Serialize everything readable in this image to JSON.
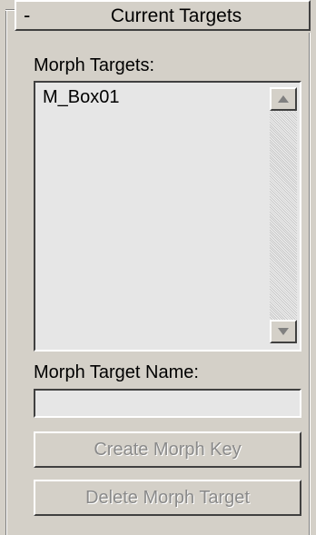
{
  "rollout": {
    "collapse_symbol": "-",
    "title": "Current Targets"
  },
  "morph_targets": {
    "label": "Morph Targets:",
    "items": [
      "M_Box01"
    ]
  },
  "morph_target_name": {
    "label": "Morph Target Name:",
    "value": ""
  },
  "buttons": {
    "create_label": "Create Morph Key",
    "delete_label": "Delete Morph Target"
  },
  "icons": {
    "scroll_up": "scroll-up-arrow-icon",
    "scroll_down": "scroll-down-arrow-icon"
  },
  "colors": {
    "panel_bg": "#d4d0c8",
    "field_bg": "#e6e6e6",
    "disabled_text": "#8a8a8a"
  }
}
